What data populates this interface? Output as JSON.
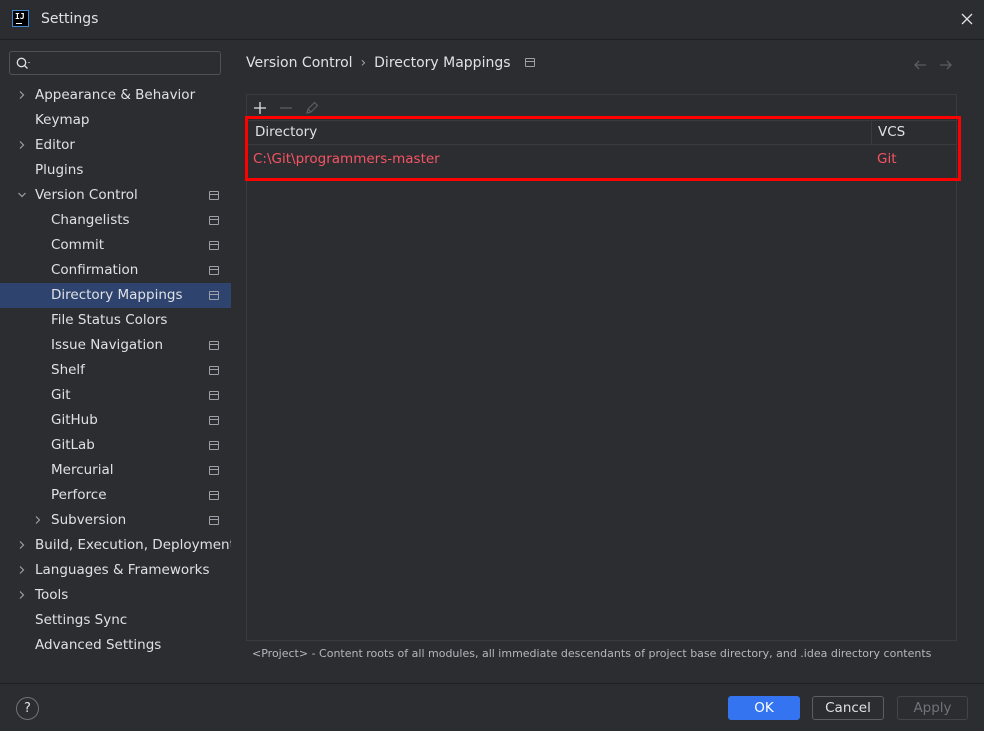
{
  "window": {
    "title": "Settings",
    "logo_text": "IJ"
  },
  "search": {
    "value": "",
    "placeholder": ""
  },
  "sidebar": {
    "items": [
      {
        "label": "Appearance & Behavior",
        "level": 0,
        "expandable": true,
        "expanded": false,
        "project_icon": false,
        "selected": false
      },
      {
        "label": "Keymap",
        "level": 0,
        "expandable": false,
        "project_icon": false,
        "selected": false
      },
      {
        "label": "Editor",
        "level": 0,
        "expandable": true,
        "expanded": false,
        "project_icon": false,
        "selected": false
      },
      {
        "label": "Plugins",
        "level": 0,
        "expandable": false,
        "project_icon": false,
        "selected": false
      },
      {
        "label": "Version Control",
        "level": 0,
        "expandable": true,
        "expanded": true,
        "project_icon": true,
        "selected": false
      },
      {
        "label": "Changelists",
        "level": 1,
        "expandable": false,
        "project_icon": true,
        "selected": false
      },
      {
        "label": "Commit",
        "level": 1,
        "expandable": false,
        "project_icon": true,
        "selected": false
      },
      {
        "label": "Confirmation",
        "level": 1,
        "expandable": false,
        "project_icon": true,
        "selected": false
      },
      {
        "label": "Directory Mappings",
        "level": 1,
        "expandable": false,
        "project_icon": true,
        "selected": true
      },
      {
        "label": "File Status Colors",
        "level": 1,
        "expandable": false,
        "project_icon": false,
        "selected": false
      },
      {
        "label": "Issue Navigation",
        "level": 1,
        "expandable": false,
        "project_icon": true,
        "selected": false
      },
      {
        "label": "Shelf",
        "level": 1,
        "expandable": false,
        "project_icon": true,
        "selected": false
      },
      {
        "label": "Git",
        "level": 1,
        "expandable": false,
        "project_icon": true,
        "selected": false
      },
      {
        "label": "GitHub",
        "level": 1,
        "expandable": false,
        "project_icon": true,
        "selected": false
      },
      {
        "label": "GitLab",
        "level": 1,
        "expandable": false,
        "project_icon": true,
        "selected": false
      },
      {
        "label": "Mercurial",
        "level": 1,
        "expandable": false,
        "project_icon": true,
        "selected": false
      },
      {
        "label": "Perforce",
        "level": 1,
        "expandable": false,
        "project_icon": true,
        "selected": false
      },
      {
        "label": "Subversion",
        "level": 1,
        "expandable": true,
        "expanded": false,
        "project_icon": true,
        "selected": false
      },
      {
        "label": "Build, Execution, Deployment",
        "level": 0,
        "expandable": true,
        "expanded": false,
        "project_icon": false,
        "selected": false
      },
      {
        "label": "Languages & Frameworks",
        "level": 0,
        "expandable": true,
        "expanded": false,
        "project_icon": false,
        "selected": false
      },
      {
        "label": "Tools",
        "level": 0,
        "expandable": true,
        "expanded": false,
        "project_icon": false,
        "selected": false
      },
      {
        "label": "Settings Sync",
        "level": 0,
        "expandable": false,
        "project_icon": false,
        "selected": false
      },
      {
        "label": "Advanced Settings",
        "level": 0,
        "expandable": false,
        "project_icon": false,
        "selected": false
      }
    ]
  },
  "breadcrumb": {
    "parent": "Version Control",
    "separator": "›",
    "current": "Directory Mappings"
  },
  "mappings_table": {
    "columns": [
      "Directory",
      "VCS"
    ],
    "rows": [
      {
        "directory": "C:\\Git\\programmers-master",
        "vcs": "Git"
      }
    ],
    "row_text_color": "#f75464"
  },
  "footnote": "<Project> - Content roots of all modules, all immediate descendants of project base directory, and .idea directory contents",
  "footer": {
    "help_label": "?",
    "ok_label": "OK",
    "cancel_label": "Cancel",
    "apply_label": "Apply"
  },
  "colors": {
    "background": "#2b2d30",
    "selection": "#2e436e",
    "accent": "#3574f0",
    "highlight_box": "#ff0000"
  }
}
